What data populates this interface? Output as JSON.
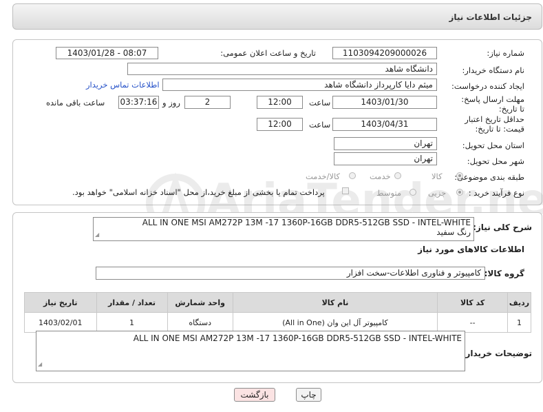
{
  "header": {
    "title": "جزئیات اطلاعات نیاز"
  },
  "form": {
    "need_number_label": "شماره نیاز:",
    "need_number": "1103094209000026",
    "announce_label": "تاریخ و ساعت اعلان عمومی:",
    "announce_value": "1403/01/28 - 08:07",
    "buyer_org_label": "نام دستگاه خریدار:",
    "buyer_org": "دانشگاه شاهد",
    "creator_label": "ایجاد کننده درخواست:",
    "creator": "میثم دایا کارپرداز دانشگاه شاهد",
    "contact_link": "اطلاعات تماس خریدار",
    "reply_deadline_label": "مهلت ارسال پاسخ: تا تاریخ:",
    "reply_date": "1403/01/30",
    "time_label": "ساعت",
    "reply_time": "12:00",
    "days_value": "2",
    "days_label": "روز و",
    "remaining_time": "03:37:16",
    "remaining_label": "ساعت باقی مانده",
    "price_validity_label": "حداقل تاریخ اعتبار قیمت: تا تاریخ:",
    "price_date": "1403/04/31",
    "price_time": "12:00",
    "province_label": "استان محل تحویل:",
    "province": "تهران",
    "city_label": "شهر محل تحویل:",
    "city": "تهران",
    "category_label": "طبقه بندی موضوعی:",
    "category_options": [
      "کالا",
      "خدمت",
      "کالا/خدمت"
    ],
    "purchase_type_label": "نوع فرآیند خرید :",
    "purchase_options": [
      "جزیی",
      "متوسط"
    ],
    "payment_note": "پرداخت تمام یا بخشی از مبلغ خرید،از محل \"اسناد خزانه اسلامی\" خواهد بود."
  },
  "details": {
    "summary_label": "شرح کلی نیاز:",
    "summary_line1": "ALL IN ONE MSI AM272P 13M -17 1360P-16GB DDR5-512GB SSD - INTEL-WHITE",
    "summary_line2": "رنگ سفید",
    "goods_info_title": "اطلاعات کالاهای مورد نیاز",
    "goods_group_label": "گروه کالا:",
    "goods_group": "کامپیوتر و فناوری اطلاعات-سخت افزار",
    "table_headers": [
      "ردیف",
      "کد کالا",
      "نام کالا",
      "واحد شمارش",
      "تعداد / مقدار",
      "تاریخ نیاز"
    ],
    "table_row": [
      "1",
      "--",
      "کامپیوتر آل این وان (All in One)",
      "دستگاه",
      "1",
      "1403/02/01"
    ],
    "buyer_notes_label": "توضیحات خریدار:",
    "buyer_notes": "ALL IN ONE MSI AM272P 13M -17 1360P-16GB DDR5-512GB SSD - INTEL-WHITE"
  },
  "buttons": {
    "print": "چاپ",
    "back": "بازگشت"
  },
  "watermark": {
    "text": "AriaTender.neT"
  },
  "colors": {
    "link": "#2450c8",
    "back_button_bg": "#fbe3e3",
    "header_grey": "#dcdcdc"
  }
}
